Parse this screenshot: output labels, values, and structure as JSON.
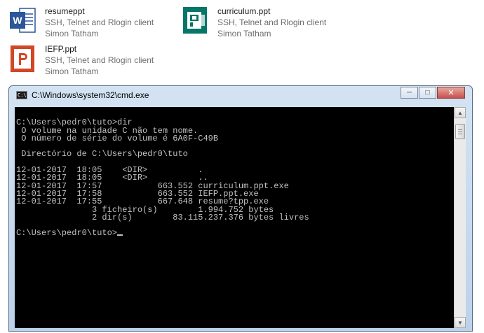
{
  "files": [
    {
      "name": "resumeppt",
      "type": "SSH, Telnet and Rlogin client",
      "company": "Simon Tatham",
      "icon": "word-document-icon",
      "color": "#2b579a"
    },
    {
      "name": "curriculum.ppt",
      "type": "SSH, Telnet and Rlogin client",
      "company": "Simon Tatham",
      "icon": "publisher-document-icon",
      "color": "#077568"
    },
    {
      "name": "IEFP.ppt",
      "type": "SSH, Telnet and Rlogin client",
      "company": "Simon Tatham",
      "icon": "powerpoint-document-icon",
      "color": "#d24726"
    }
  ],
  "window": {
    "title": "C:\\Windows\\system32\\cmd.exe",
    "icon_glyph": "C:\\",
    "controls": {
      "minimize": "─",
      "maximize": "□",
      "close": "✕"
    }
  },
  "console": {
    "lines": [
      "",
      "C:\\Users\\pedr0\\tuto>dir",
      " O volume na unidade C não tem nome.",
      " O número de série do volume é 6A0F-C49B",
      "",
      " Directório de C:\\Users\\pedr0\\tuto",
      "",
      "12-01-2017  18:05    <DIR>          .",
      "12-01-2017  18:05    <DIR>          ..",
      "12-01-2017  17:57           663.552 curriculum.ppt.exe",
      "12-01-2017  17:58           663.552 IEFP.ppt.exe",
      "12-01-2017  17:55           667.648 resume?tpp.exe",
      "               3 ficheiro(s)        1.994.752 bytes",
      "               2 dir(s)        83.115.237.376 bytes livres",
      "",
      "C:\\Users\\pedr0\\tuto>"
    ]
  },
  "scrollbar": {
    "up_glyph": "▲",
    "down_glyph": "▼"
  }
}
